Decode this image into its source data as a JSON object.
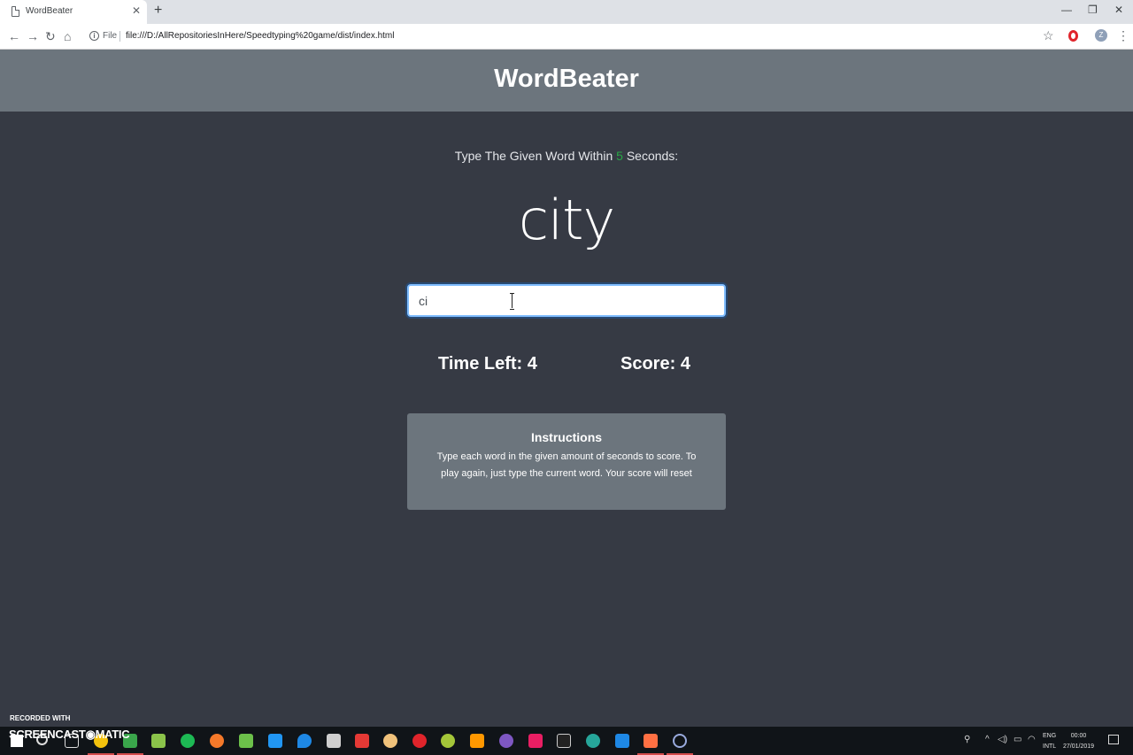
{
  "browser": {
    "tab_title": "WordBeater",
    "url_scheme": "File",
    "url": "file:///D:/AllRepositoriesInHere/Speedtyping%20game/dist/index.html"
  },
  "page": {
    "brand": "WordBeater",
    "lead_prefix": "Type The Given Word Within",
    "seconds": "5",
    "lead_suffix": "Seconds:",
    "current_word": "city",
    "input_value": "ci",
    "time_label": "Time Left:",
    "time_value": "4",
    "score_label": "Score:",
    "score_value": "4",
    "instructions_title": "Instructions",
    "instructions_text": "Type each word in the given amount of seconds to score. To play again, just type the current word. Your score will reset"
  },
  "watermark": {
    "line1": "RECORDED WITH",
    "line2": "SCREENCAST◉MATIC"
  },
  "taskbar": {
    "lang_top": "ENG",
    "lang_bottom": "INTL",
    "time": "00:00",
    "date": "27/01/2019"
  },
  "colors": {
    "page_bg": "#363a44",
    "header_bg": "#6c757d",
    "accent_seconds": "#28a745",
    "taskbar_bg": "#101418"
  }
}
